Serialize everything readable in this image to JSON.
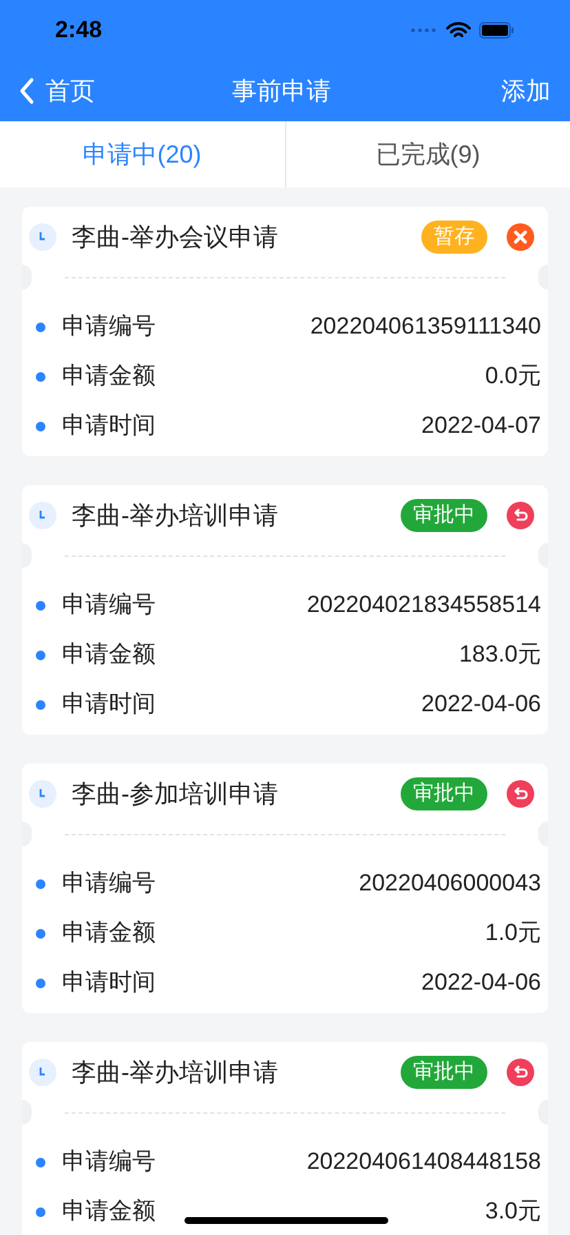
{
  "status_bar": {
    "time": "2:48"
  },
  "nav": {
    "back": "首页",
    "title": "事前申请",
    "action": "添加"
  },
  "tabs": [
    {
      "label": "申请中(20)",
      "selected": true
    },
    {
      "label": "已完成(9)",
      "selected": false
    }
  ],
  "applications": [
    {
      "title": "李曲-举办会议申请",
      "status": {
        "kind": "draft",
        "label": "暂存"
      },
      "action": {
        "kind": "delete"
      },
      "fields": [
        {
          "label": "申请编号",
          "value": "202204061359111340"
        },
        {
          "label": "申请金额",
          "value": "0.0元"
        },
        {
          "label": "申请时间",
          "value": "2022-04-07"
        }
      ]
    },
    {
      "title": "李曲-举办培训申请",
      "status": {
        "kind": "approving",
        "label": "审批中"
      },
      "action": {
        "kind": "withdraw"
      },
      "fields": [
        {
          "label": "申请编号",
          "value": "202204021834558514"
        },
        {
          "label": "申请金额",
          "value": "183.0元"
        },
        {
          "label": "申请时间",
          "value": "2022-04-06"
        }
      ]
    },
    {
      "title": "李曲-参加培训申请",
      "status": {
        "kind": "approving",
        "label": "审批中"
      },
      "action": {
        "kind": "withdraw"
      },
      "fields": [
        {
          "label": "申请编号",
          "value": "20220406000043"
        },
        {
          "label": "申请金额",
          "value": "1.0元"
        },
        {
          "label": "申请时间",
          "value": "2022-04-06"
        }
      ]
    },
    {
      "title": "李曲-举办培训申请",
      "status": {
        "kind": "approving",
        "label": "审批中"
      },
      "action": {
        "kind": "withdraw"
      },
      "fields": [
        {
          "label": "申请编号",
          "value": "202204061408448158"
        },
        {
          "label": "申请金额",
          "value": "3.0元"
        }
      ]
    }
  ]
}
